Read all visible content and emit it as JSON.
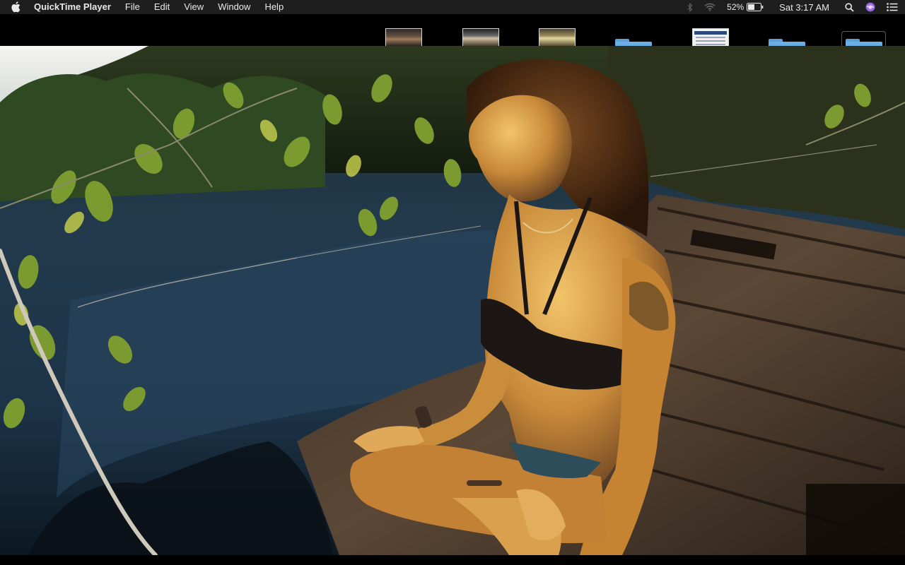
{
  "menubar": {
    "app_name": "QuickTime Player",
    "menus": [
      "File",
      "Edit",
      "View",
      "Window",
      "Help"
    ],
    "status": {
      "battery_percent": "52%",
      "clock": "Sat 3:17 AM"
    },
    "icons": {
      "apple": "apple-icon",
      "bluetooth": "bluetooth-icon",
      "wifi": "wifi-icon",
      "battery": "battery-icon",
      "spotlight": "search-icon",
      "siri": "siri-icon",
      "notifications": "notification-center-icon"
    }
  },
  "strip": {
    "items": [
      {
        "kind": "video-thumbnail"
      },
      {
        "kind": "video-thumbnail"
      },
      {
        "kind": "video-thumbnail"
      },
      {
        "kind": "folder"
      },
      {
        "kind": "window-thumbnail"
      },
      {
        "kind": "folder"
      },
      {
        "kind": "folder",
        "selected": true
      }
    ]
  },
  "video": {
    "description_colors": {
      "water": "#0f2230",
      "foliage": "#6d8a2a",
      "dock": "#5a4530",
      "skin": "#d9a24a"
    }
  }
}
